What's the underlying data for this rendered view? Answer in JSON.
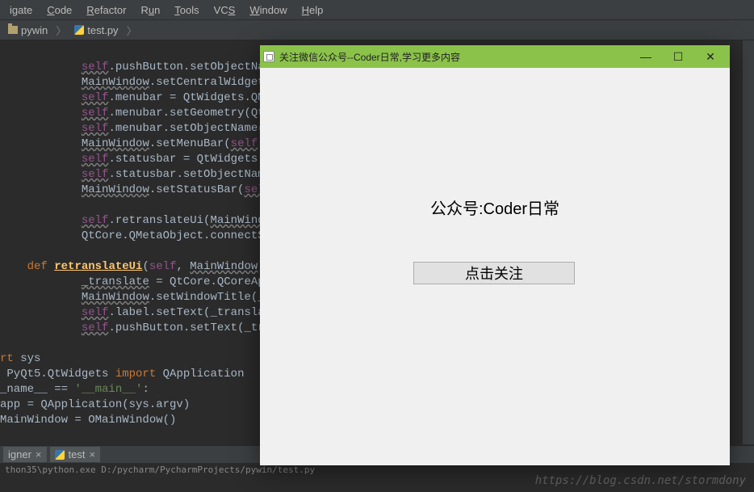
{
  "menu": {
    "items": [
      "igate",
      "Code",
      "Refactor",
      "Run",
      "Tools",
      "VCS",
      "Window",
      "Help"
    ],
    "underlines": [
      "i",
      "C",
      "R",
      "u",
      "T",
      "S",
      "W",
      "H"
    ]
  },
  "breadcrumbs": {
    "folder": "pywin",
    "file": "test.py"
  },
  "code": {
    "lines": [
      {
        "html": "            <span class='c-self wavy'>self</span>.pushButton.setObjectName(<span class='c-str'>\"p</span>"
      },
      {
        "html": "            <span class='c-mw wavy'>MainWindow</span>.setCentralWidget(<span class='c-self wavy'>self</span>"
      },
      {
        "html": "            <span class='c-self wavy'>self</span>.menubar = QtWidgets.QMenuBa"
      },
      {
        "html": "            <span class='c-self wavy'>self</span>.menubar.setGeometry(QtCore."
      },
      {
        "html": "            <span class='c-self wavy'>self</span>.menubar.setObjectName(<span class='c-str'>\"menu</span>"
      },
      {
        "html": "            <span class='c-mw wavy'>MainWindow</span>.setMenuBar(<span class='c-self wavy'>self</span>.menub"
      },
      {
        "html": "            <span class='c-self wavy'>self</span>.statusbar = QtWidgets.QStat"
      },
      {
        "html": "            <span class='c-self wavy'>self</span>.statusbar.setObjectName(<span class='c-str'>\"st</span>"
      },
      {
        "html": "            <span class='c-mw wavy'>MainWindow</span>.setStatusBar(<span class='c-self wavy'>self</span>.sta"
      },
      {
        "html": " "
      },
      {
        "html": "            <span class='c-self wavy'>self</span>.retranslateUi(<span class='wavy'>MainWindow</span>)"
      },
      {
        "html": "            QtCore.QMetaObject.connectSlotsB"
      },
      {
        "html": " "
      },
      {
        "html": "    <span class='c-def'>def</span> <span class='c-funcname'>retranslateUi</span>(<span class='c-self'>self</span>, <span class='wavy'>MainWindow</span>):"
      },
      {
        "html": "            <span class='wavy'>_translate</span> = QtCore.QCoreApplica"
      },
      {
        "html": "            <span class='c-mw wavy'>MainWindow</span>.setWindowTitle(_trans"
      },
      {
        "html": "            <span class='c-self wavy'>self</span>.label.setText(_translate(<span class='c-str'>\"M</span>"
      },
      {
        "html": "            <span class='c-self wavy'>self</span>.pushButton.setText(_transla"
      },
      {
        "html": " "
      },
      {
        "html": "<span class='c-kw'>rt</span> sys"
      },
      {
        "html": " PyQt5.QtWidgets <span class='c-kw'>import</span> QApplication"
      },
      {
        "html": "_name__ == <span class='c-str'>'__main__'</span>:"
      },
      {
        "html": "app = QApplication(sys.argv)"
      },
      {
        "html": "MainWindow = OMainWindow()"
      }
    ]
  },
  "bottom_tabs": [
    {
      "label": "igner",
      "icon": "folder"
    },
    {
      "label": "test",
      "icon": "py"
    }
  ],
  "statusbar": {
    "text": "thon35\\python.exe D:/pycharm/PycharmProjects/pywin/test.py"
  },
  "watermark": "https://blog.csdn.net/stormdony",
  "app_window": {
    "title": "关注微信公众号--Coder日常,学习更多内容",
    "label": "公众号:Coder日常",
    "button": "点击关注",
    "minimize": "—",
    "maximize": "☐",
    "close": "✕"
  }
}
